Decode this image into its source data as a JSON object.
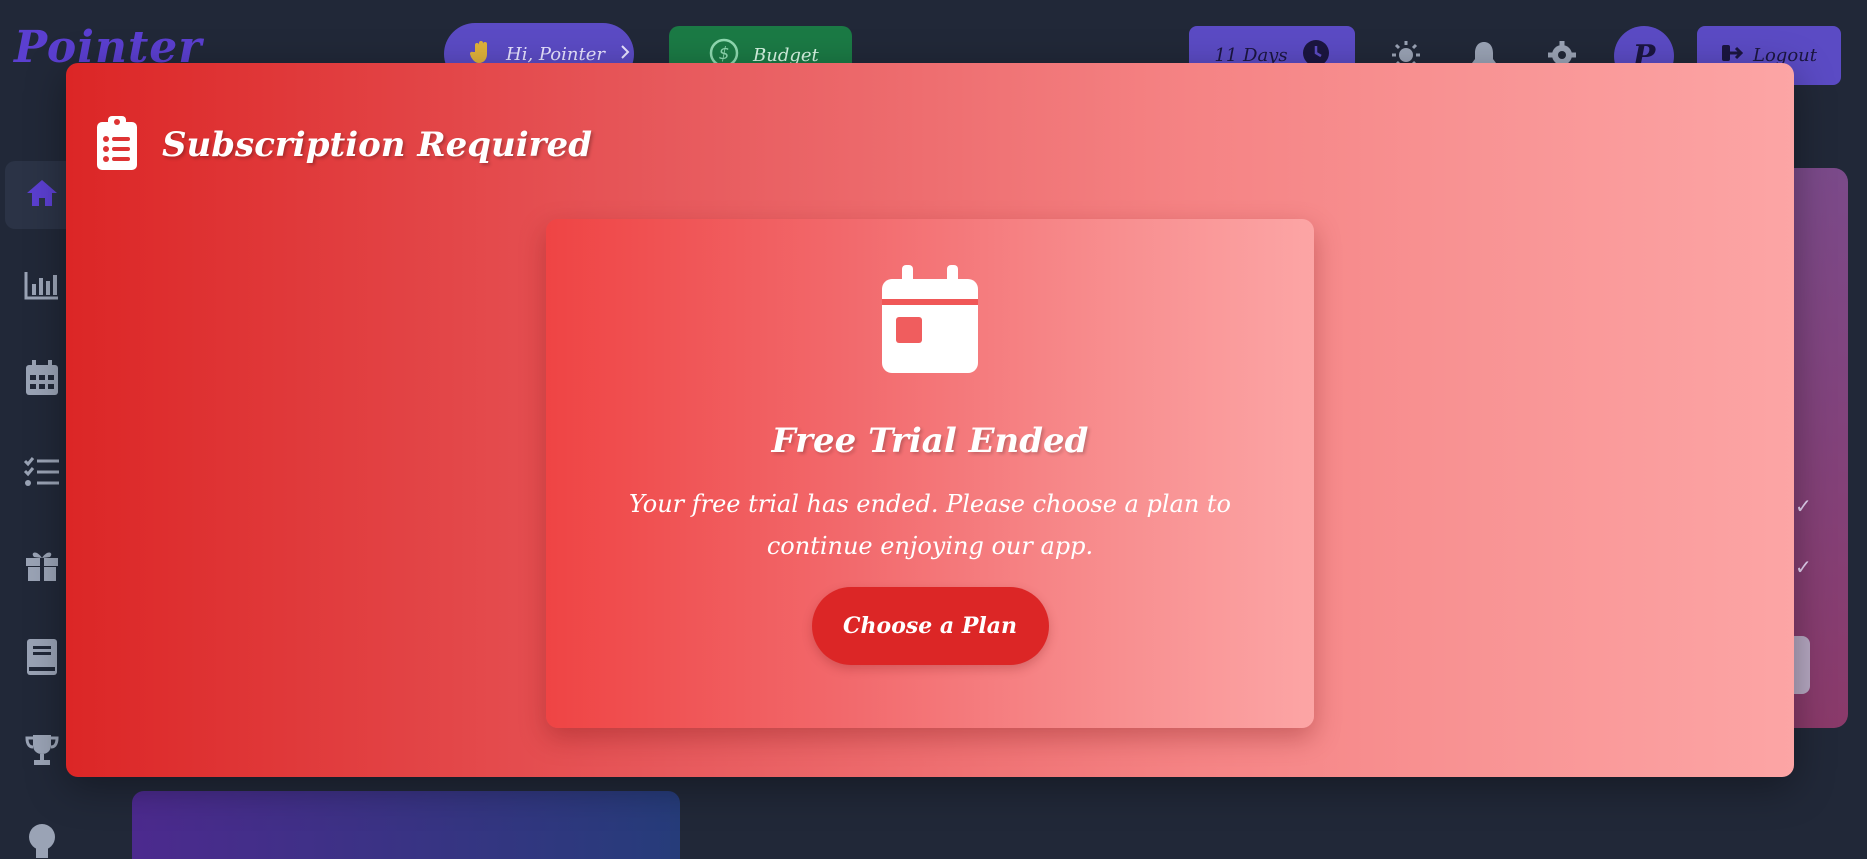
{
  "app": {
    "logo": "Pointer",
    "greeting_pill": "Hi, Pointer",
    "budget_label": "Budget",
    "days_label": "11 Days",
    "avatar_initial": "P",
    "logout_label": "Logout"
  },
  "sidebar": {
    "items": [
      {
        "icon": "home-icon",
        "active": true
      },
      {
        "icon": "chart-icon"
      },
      {
        "icon": "calendar-icon"
      },
      {
        "icon": "checklist-icon"
      },
      {
        "icon": "gift-icon"
      },
      {
        "icon": "book-icon"
      },
      {
        "icon": "trophy-icon"
      },
      {
        "icon": "lightbulb-icon"
      }
    ]
  },
  "modal": {
    "title": "Subscription Required",
    "card_title": "Free Trial Ended",
    "card_description": "Your free trial has ended. Please choose a plan to continue enjoying our app.",
    "button_label": "Choose a Plan"
  },
  "colors": {
    "background": "#212838",
    "accent_purple": "#5b4bc4",
    "budget_green": "#1b7a45",
    "modal_red": "#dc2626",
    "modal_pink": "#fca5a5"
  }
}
